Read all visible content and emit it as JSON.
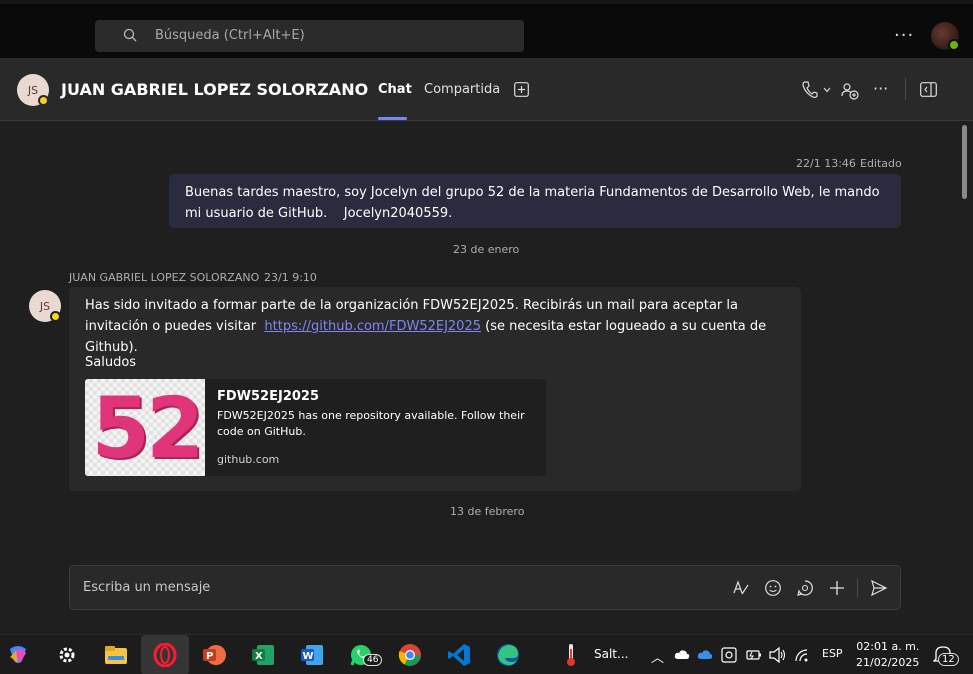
{
  "search": {
    "placeholder": "Búsqueda (Ctrl+Alt+E)"
  },
  "header": {
    "avatar_initials": "JS",
    "name": "JUAN GABRIEL LOPEZ SOLORZANO",
    "tabs": [
      {
        "label": "Chat",
        "active": true
      },
      {
        "label": "Compartida",
        "active": false
      }
    ]
  },
  "messages": {
    "sent": {
      "timestamp": "22/1 13:46",
      "edited_label": "Editado",
      "text": "Buenas tardes maestro, soy Jocelyn del grupo 52 de la materia Fundamentos de Desarrollo Web, le mando mi usuario de GitHub.    Jocelyn2040559."
    },
    "date_sep_1": "23 de enero",
    "received": {
      "sender": "JUAN GABRIEL LOPEZ SOLORZANO",
      "timestamp": "23/1 9:10",
      "avatar_initials": "JS",
      "text_before_link": "Has sido invitado a formar parte de la organización FDW52EJ2025. Recibirás un mail para aceptar la invitación o puedes visitar",
      "link": "https://github.com/FDW52EJ2025",
      "text_after_link": "(se necesita estar logueado a su cuenta de Github).",
      "closing": "Saludos",
      "card": {
        "logo_text": "52",
        "title": "FDW52EJ2025",
        "description": "FDW52EJ2025 has one repository available. Follow their code on GitHub.",
        "domain": "github.com"
      }
    },
    "date_sep_2": "13 de febrero"
  },
  "compose": {
    "placeholder": "Escriba un mensaje"
  },
  "taskbar": {
    "whatsapp_badge": "46",
    "weather_text": "Salt...",
    "language": "ESP",
    "time": "02:01 a. m.",
    "date": "21/02/2025",
    "notification_count": "12"
  },
  "colors": {
    "accent": "#7f85f5",
    "sent_bubble": "#2b2b40",
    "received_bubble": "#292929",
    "away_status": "#f8d22a",
    "online_status": "#6bb700"
  }
}
